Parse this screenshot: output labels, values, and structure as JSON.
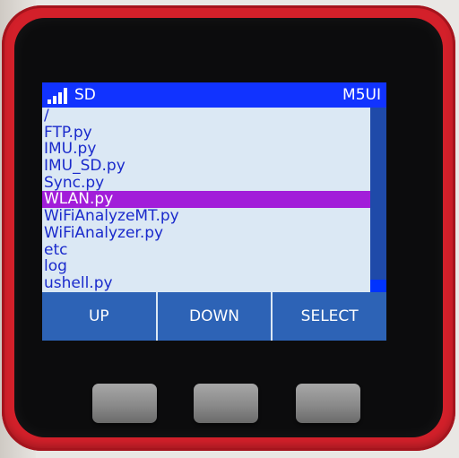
{
  "titlebar": {
    "label": "SD",
    "right_label": "M5UI"
  },
  "file_list": {
    "items": [
      {
        "name": "/",
        "selected": false
      },
      {
        "name": "FTP.py",
        "selected": false
      },
      {
        "name": "IMU.py",
        "selected": false
      },
      {
        "name": "IMU_SD.py",
        "selected": false
      },
      {
        "name": "Sync.py",
        "selected": false
      },
      {
        "name": "WLAN.py",
        "selected": true
      },
      {
        "name": "WiFiAnalyzeMT.py",
        "selected": false
      },
      {
        "name": "WiFiAnalyzer.py",
        "selected": false
      },
      {
        "name": "etc",
        "selected": false
      },
      {
        "name": "log",
        "selected": false
      },
      {
        "name": "ushell.py",
        "selected": false
      }
    ]
  },
  "buttons": {
    "up": "UP",
    "down": "DOWN",
    "select": "SELECT"
  },
  "colors": {
    "titlebar": "#1133ff",
    "selection": "#a21ed9",
    "list_text": "#1a2acc",
    "button_bar": "#2d63b6",
    "device_body": "#d3202a"
  },
  "icons": {
    "signal": "signal-strength-icon"
  }
}
